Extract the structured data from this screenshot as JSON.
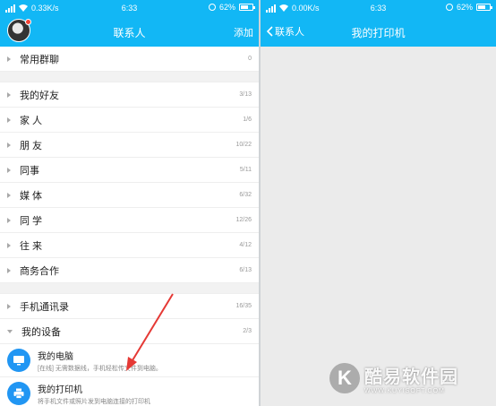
{
  "left": {
    "status": {
      "speed": "0.33K/s",
      "time": "6:33",
      "battery": "62%"
    },
    "header": {
      "title": "联系人",
      "add": "添加"
    },
    "groups_top": [
      {
        "name": "常用群聊",
        "count": "0"
      }
    ],
    "groups": [
      {
        "name": "我的好友",
        "count": "3/13"
      },
      {
        "name": "家 人",
        "count": "1/6"
      },
      {
        "name": "朋 友",
        "count": "10/22"
      },
      {
        "name": "同事",
        "count": "5/11"
      },
      {
        "name": "媒 体",
        "count": "6/32"
      },
      {
        "name": "同 学",
        "count": "12/26"
      },
      {
        "name": "往 来",
        "count": "4/12"
      },
      {
        "name": "商务合作",
        "count": "6/13"
      }
    ],
    "groups_bottom": [
      {
        "name": "手机通讯录",
        "count": "16/35"
      },
      {
        "name": "我的设备",
        "count": "2/3"
      }
    ],
    "devices": [
      {
        "name": "我的电脑",
        "desc": "[在线] 无需数据线，手机轻松传文件到电脑。"
      },
      {
        "name": "我的打印机",
        "desc": "将手机文件或照片发到电脑连接的打印机"
      }
    ]
  },
  "right": {
    "status": {
      "speed": "0.00K/s",
      "time": "6:33",
      "battery": "62%"
    },
    "header": {
      "back": "联系人",
      "title": "我的打印机"
    }
  },
  "watermark": {
    "logo": "K",
    "text": "酷易软件园",
    "sub": "WWW.KUYISOFT.COM"
  },
  "colors": {
    "accent": "#12b7f5",
    "arrow": "#e53935",
    "device_icon": "#2196f3"
  }
}
